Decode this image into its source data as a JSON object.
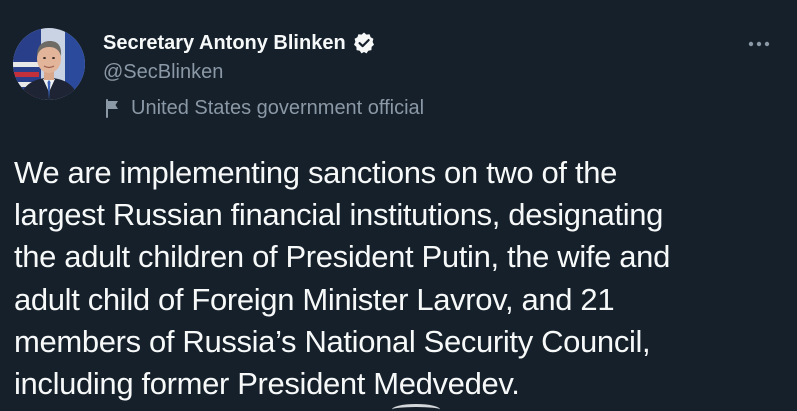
{
  "author": {
    "display_name": "Secretary Antony Blinken",
    "handle": "@SecBlinken",
    "verified": true,
    "label": "United States government official",
    "avatar_icon": "profile-photo"
  },
  "icons": {
    "verified": "verified-badge-icon",
    "label": "flag-icon",
    "more": "more-horizontal-icon"
  },
  "colors": {
    "background": "#15202b",
    "primary_text": "#f7f9f9",
    "secondary_text": "#8b98a5"
  },
  "tweet": {
    "text": "We are implementing sanctions on two of the\nlargest Russian financial institutions, designating\nthe adult children of President Putin, the wife and\nadult child of Foreign Minister Lavrov, and 21\nmembers of Russia’s National Security Council,\nincluding former President Medvedev."
  }
}
